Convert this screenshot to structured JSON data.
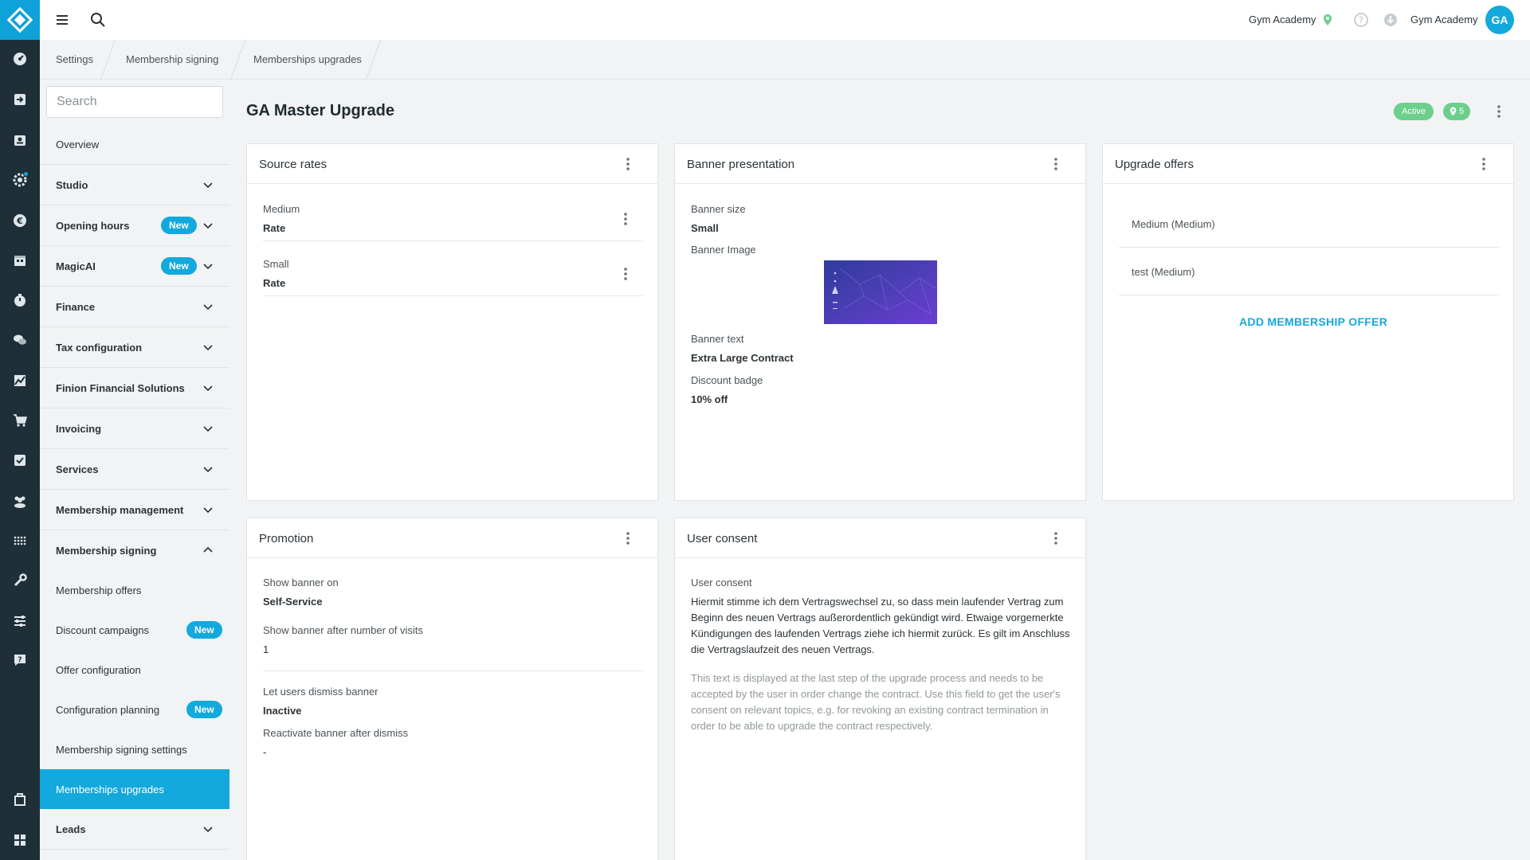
{
  "colors": {
    "accent": "#13a9dc",
    "rail": "#1f2f38",
    "status_active": "#6ccf8c"
  },
  "rail": {
    "icons": [
      "dashboard-icon",
      "check-in-icon",
      "members-icon",
      "settings-gear-icon",
      "euro-icon",
      "calendar-icon",
      "timer-icon",
      "chat-icon",
      "chart-icon",
      "cart-icon",
      "checklist-icon",
      "groups-icon",
      "grid-icon",
      "tools-icon",
      "sliders-icon",
      "help-chat-icon",
      "store-icon",
      "apps-icon"
    ]
  },
  "topbar": {
    "studio_name": "Gym Academy",
    "user_name": "Gym Academy",
    "avatar_initials": "GA"
  },
  "breadcrumb": [
    "Settings",
    "Membership signing",
    "Memberships upgrades"
  ],
  "sidebar": {
    "search_placeholder": "Search",
    "items": [
      {
        "label": "Overview"
      },
      {
        "label": "Studio"
      },
      {
        "label": "Opening hours",
        "badge": "New"
      },
      {
        "label": "MagicAI",
        "badge": "New"
      },
      {
        "label": "Finance"
      },
      {
        "label": "Tax configuration"
      },
      {
        "label": "Finion Financial Solutions"
      },
      {
        "label": "Invoicing"
      },
      {
        "label": "Services"
      },
      {
        "label": "Membership management"
      },
      {
        "label": "Membership signing"
      },
      {
        "label": "Leads"
      }
    ],
    "sub_items": [
      {
        "label": "Membership offers"
      },
      {
        "label": "Discount campaigns",
        "badge": "New"
      },
      {
        "label": "Offer configuration"
      },
      {
        "label": "Configuration planning",
        "badge": "New"
      },
      {
        "label": "Membership signing settings"
      },
      {
        "label": "Memberships upgrades"
      }
    ]
  },
  "page": {
    "title": "GA Master Upgrade",
    "status": "Active",
    "location_count": "5"
  },
  "source_rates": {
    "title": "Source rates",
    "rows": [
      {
        "name": "Medium",
        "type": "Rate"
      },
      {
        "name": "Small",
        "type": "Rate"
      }
    ]
  },
  "banner": {
    "title": "Banner presentation",
    "size_label": "Banner size",
    "size_value": "Small",
    "image_label": "Banner Image",
    "text_label": "Banner text",
    "text_value": "Extra Large Contract",
    "badge_label": "Discount badge",
    "badge_value": "10% off"
  },
  "upgrade_offers": {
    "title": "Upgrade offers",
    "items": [
      "Medium (Medium)",
      "test (Medium)"
    ],
    "add_label": "ADD MEMBERSHIP OFFER"
  },
  "promotion": {
    "title": "Promotion",
    "show_on_label": "Show banner on",
    "show_on_value": "Self-Service",
    "after_visits_label": "Show banner after number of visits",
    "after_visits_value": "1",
    "dismiss_label": "Let users dismiss banner",
    "dismiss_value": "Inactive",
    "reactivate_label": "Reactivate banner after dismiss",
    "reactivate_value": "-"
  },
  "consent": {
    "title": "User consent",
    "label": "User consent",
    "text": "Hiermit stimme ich dem Vertragswechsel zu, so dass mein laufender Vertrag zum Beginn des neuen Vertrags außerordentlich gekündigt wird. Etwaige vorgemerkte Kündigungen des laufenden Vertrags ziehe ich hiermit zurück. Es gilt im Anschluss die Vertragslaufzeit des neuen Vertrags.",
    "help": "This text is displayed at the last step of the upgrade process and needs to be accepted by the user in order change the contract. Use this field to get the user's consent on relevant topics, e.g. for revoking an existing contract termination in order to be able to upgrade the contract respectively."
  }
}
